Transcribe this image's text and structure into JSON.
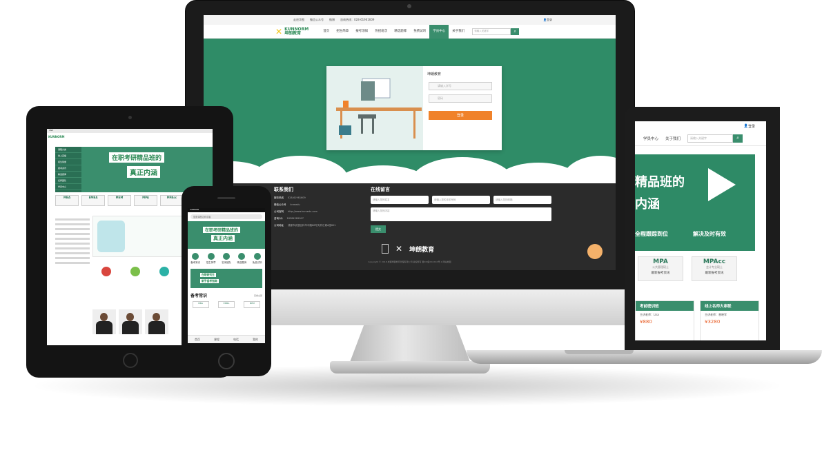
{
  "desktop": {
    "topbar": [
      "走进华图",
      "微信公众号",
      "微博",
      "咨询热线：028-61961609"
    ],
    "login": "登录",
    "logo": {
      "en": "KUNNORM",
      "cn": "坤朗教育"
    },
    "nav": [
      "首页",
      "招生简章",
      "报考须知",
      "热招班次",
      "精选题库",
      "免费试听",
      "学员中心",
      "关于我们"
    ],
    "active_nav_index": 6,
    "search_placeholder": "请输入关键字",
    "login_card": {
      "title": "坤朗教育",
      "username_placeholder": "请输入学号",
      "password_placeholder": "密码",
      "button": "登录"
    },
    "contact": {
      "title": "联系我们",
      "rows": [
        {
          "k": "服务热线",
          "v": "028-61961609"
        },
        {
          "k": "微信公众号",
          "v": "knmedu"
        },
        {
          "k": "公司官网",
          "v": "http://www.knmedu.com"
        },
        {
          "k": "咨询QQ",
          "v": "18584289997"
        },
        {
          "k": "公司地址",
          "v": "成都市武侯区科华中路88号天府汇城A座601"
        }
      ]
    },
    "message": {
      "title": "在线留言",
      "inputs": [
        "请输入您的姓名",
        "请输入您的手机号码",
        "请输入您的邮箱"
      ],
      "textarea": "请输入您的内容",
      "button": "提交"
    },
    "footer_logo": "坤朗教育",
    "copyright": "Copyright © 2018 成都坤朗教育管理有限公司 版权所有 蜀ICP备XXXXXX号-1 网站地图"
  },
  "laptop": {
    "login": "登录",
    "nav": [
      "学员中心",
      "关于我们"
    ],
    "search_placeholder": "请输入关键字",
    "banner": {
      "line1": "精品班的",
      "line2": "内涵",
      "tags": [
        "全程跟踪到位",
        "解决及时有效"
      ]
    },
    "cards": [
      {
        "title": "MPA",
        "sub": "公共管理硕士",
        "note": "最新报考资讯"
      },
      {
        "title": "MPAcc",
        "sub": "会计专业硕士",
        "note": "最新报考资讯"
      }
    ],
    "boxes": [
      {
        "title": "考前密训班",
        "line": "主讲老师：Lisa",
        "price": "¥880"
      },
      {
        "title": "线上名师大串联",
        "line": "主讲老师：曾晓军",
        "price": "¥3280"
      }
    ]
  },
  "tablet": {
    "status": "iPad",
    "brand": "KUNNORM",
    "side_menu": [
      "课程分类",
      "线上直播",
      "招生简章",
      "报考资讯",
      "精选题库",
      "名师团队",
      "学员中心"
    ],
    "hero": {
      "line1": "在职考研精品班的",
      "line2": "真正内涵"
    },
    "cards": [
      "MBA",
      "EMBA",
      "MEM",
      "MPA",
      "MPAcc"
    ]
  },
  "phone": {
    "status": "CARRIER",
    "search_placeholder": "搜索课程名称或者",
    "hero": {
      "line1": "在职考研精品班的",
      "line2": "真正内涵"
    },
    "icons": [
      "备考常识",
      "招生简章",
      "名师团队",
      "精选题库",
      "免费试听"
    ],
    "banner2": {
      "line1": "在职研究生",
      "line2": "新手备考指南"
    },
    "section": {
      "title": "备考常识",
      "more": "查看全部"
    },
    "tags": [
      "MBA",
      "EMBA",
      "MEM"
    ],
    "bottom": [
      "首页",
      "课程",
      "电话",
      "我的"
    ]
  },
  "colors": {
    "brand_green": "#3a8e6d",
    "accent_orange": "#f0822a",
    "logo_yellow": "#f3c619"
  }
}
